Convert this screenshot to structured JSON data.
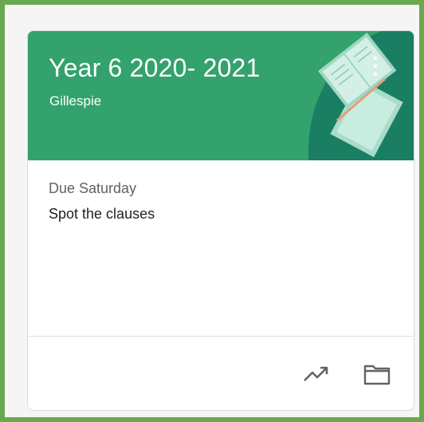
{
  "class_card": {
    "title": "Year 6 2020- 2021",
    "teacher": "Gillespie",
    "due_label": "Due Saturday",
    "assignment": "Spot the clauses",
    "banner_color": "#33a26d",
    "frame_color": "#6aa84f",
    "icons": {
      "more": "more-vert-icon",
      "gradebook": "trending-up-icon",
      "folder": "folder-icon"
    }
  }
}
